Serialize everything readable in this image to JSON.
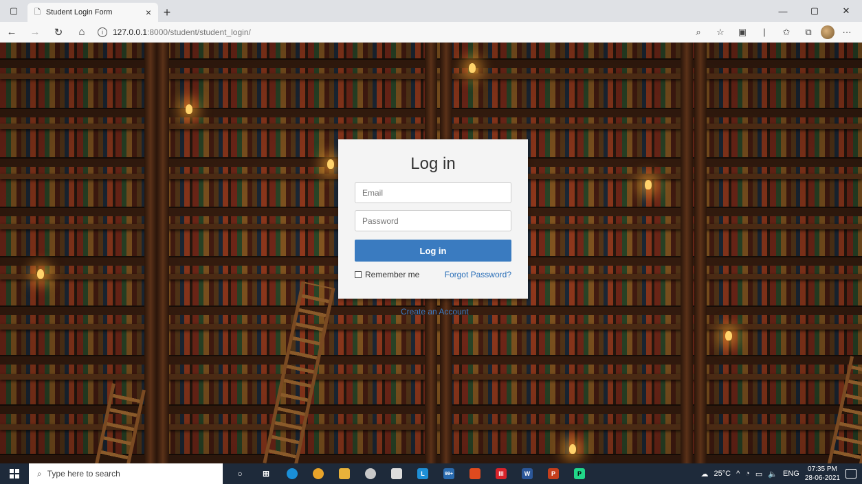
{
  "browser": {
    "tab_title": "Student Login Form",
    "url_host": "127.0.0.1",
    "url_rest": ":8000/student/student_login/"
  },
  "login": {
    "heading": "Log in",
    "email_placeholder": "Email",
    "password_placeholder": "Password",
    "submit_label": "Log in",
    "remember_label": "Remember me",
    "forgot_label": "Forgot Password?",
    "create_account_label": "Create an Account"
  },
  "taskbar": {
    "search_placeholder": "Type here to search",
    "weather": "25°C",
    "language": "ENG",
    "time": "07:35 PM",
    "date": "28-06-2021",
    "badge_count": "99+"
  },
  "colors": {
    "primary_button": "#3a7bc0",
    "link": "#2a6fb8",
    "card_bg": "#f4f4f4",
    "taskbar_bg": "#1e2a3a"
  }
}
